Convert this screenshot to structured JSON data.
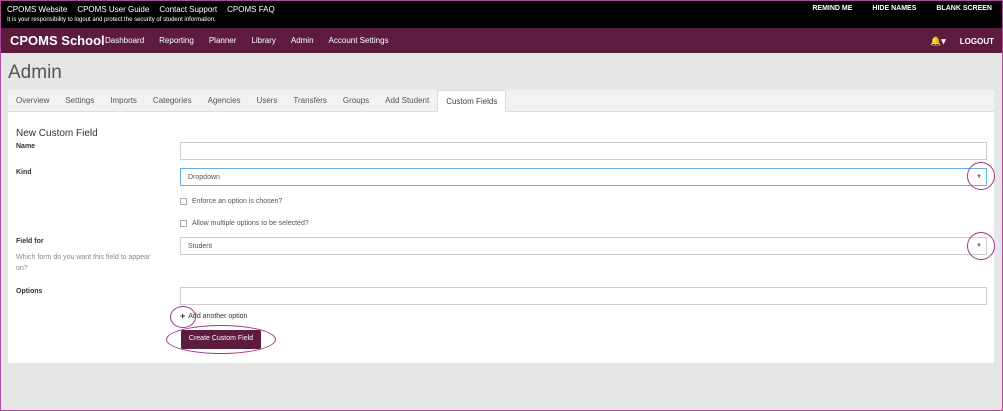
{
  "top_links": [
    "CPOMS Website",
    "CPOMS User Guide",
    "Contact Support",
    "CPOMS FAQ"
  ],
  "top_note": "It is your responsibility to logout and protect the security of student information.",
  "top_right": [
    "REMIND ME",
    "HIDE NAMES",
    "BLANK SCREEN"
  ],
  "brand": "CPOMS School",
  "nav": [
    "Dashboard",
    "Reporting",
    "Planner",
    "Library",
    "Admin",
    "Account Settings"
  ],
  "logout": "LOGOUT",
  "page_title": "Admin",
  "tabs": [
    "Overview",
    "Settings",
    "Imports",
    "Categories",
    "Agencies",
    "Users",
    "Transfers",
    "Groups",
    "Add Student",
    "Custom Fields"
  ],
  "form": {
    "title": "New Custom Field",
    "name_label": "Name",
    "kind_label": "Kind",
    "kind_value": "Dropdown",
    "enforce_label": "Enforce an option is chosen?",
    "multiple_label": "Allow multiple options to be selected?",
    "field_for_label": "Field for",
    "field_for_help": "Which form do you want this field to appear on?",
    "field_for_value": "Student",
    "options_label": "Options",
    "add_option": "Add another option",
    "submit": "Create Custom Field"
  },
  "icons": {
    "bell": "bell-icon",
    "plus": "plus-icon",
    "caret": "chevron-down-icon"
  },
  "colors": {
    "brand": "#5d1c3e",
    "annotation": "#9c3a86"
  }
}
